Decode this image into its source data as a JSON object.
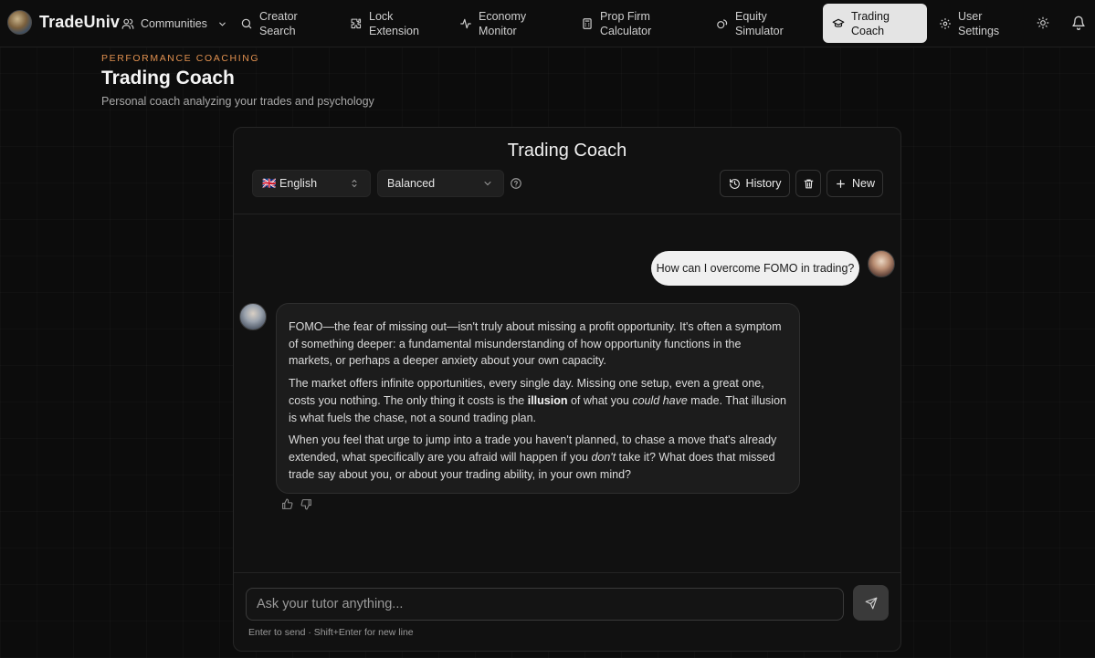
{
  "app": {
    "brand": "TradeUniv"
  },
  "nav": {
    "communities": "Communities",
    "creator_search": "Creator\nSearch",
    "lock_extension": "Lock\nExtension",
    "economy_monitor": "Economy\nMonitor",
    "prop_firm_calculator": "Prop Firm\nCalculator",
    "equity_simulator": "Equity\nSimulator",
    "trading_coach": "Trading\nCoach",
    "user_settings": "User\nSettings",
    "active": "trading_coach"
  },
  "header": {
    "kicker": "PERFORMANCE COACHING",
    "title": "Trading Coach",
    "subtitle": "Personal coach analyzing your trades and psychology"
  },
  "panel": {
    "title": "Trading Coach",
    "language": "🇬🇧 English",
    "mode": "Balanced",
    "history_label": "History",
    "new_label": "New"
  },
  "chat": {
    "user_message": "How can I overcome FOMO in trading?",
    "coach": {
      "p1": "FOMO—the fear of missing out—isn't truly about missing a profit opportunity. It's often a symptom of something deeper: a fundamental misunderstanding of how opportunity functions in the markets, or perhaps a deeper anxiety about your own capacity.",
      "p2_a": "The market offers infinite opportunities, every single day. Missing one setup, even a great one, costs you nothing. The only thing it costs is the ",
      "p2_b": "illusion",
      "p2_c": " of what you ",
      "p2_d": "could have",
      "p2_e": " made. That illusion is what fuels the chase, not a sound trading plan.",
      "p3_a": "When you feel that urge to jump into a trade you haven't planned, to chase a move that's already extended, what specifically are you afraid will happen if you ",
      "p3_b": "don't",
      "p3_c": " take it? What does that missed trade say about you, or about your trading ability, in your own mind?"
    },
    "input_placeholder": "Ask your tutor anything...",
    "hint": "Enter to send · Shift+Enter for new line"
  },
  "icons": {
    "communities": "users-icon",
    "creator_search": "search-icon",
    "lock_extension": "puzzle-icon",
    "economy_monitor": "activity-icon",
    "prop_firm_calculator": "calculator-icon",
    "equity_simulator": "coins-icon",
    "trading_coach": "graduation-cap-icon",
    "user_settings": "gear-icon",
    "theme": "sun-icon",
    "notifications": "bell-icon"
  },
  "colors": {
    "accent": "#e0904f",
    "active_tab_bg": "#e4e4e4"
  }
}
